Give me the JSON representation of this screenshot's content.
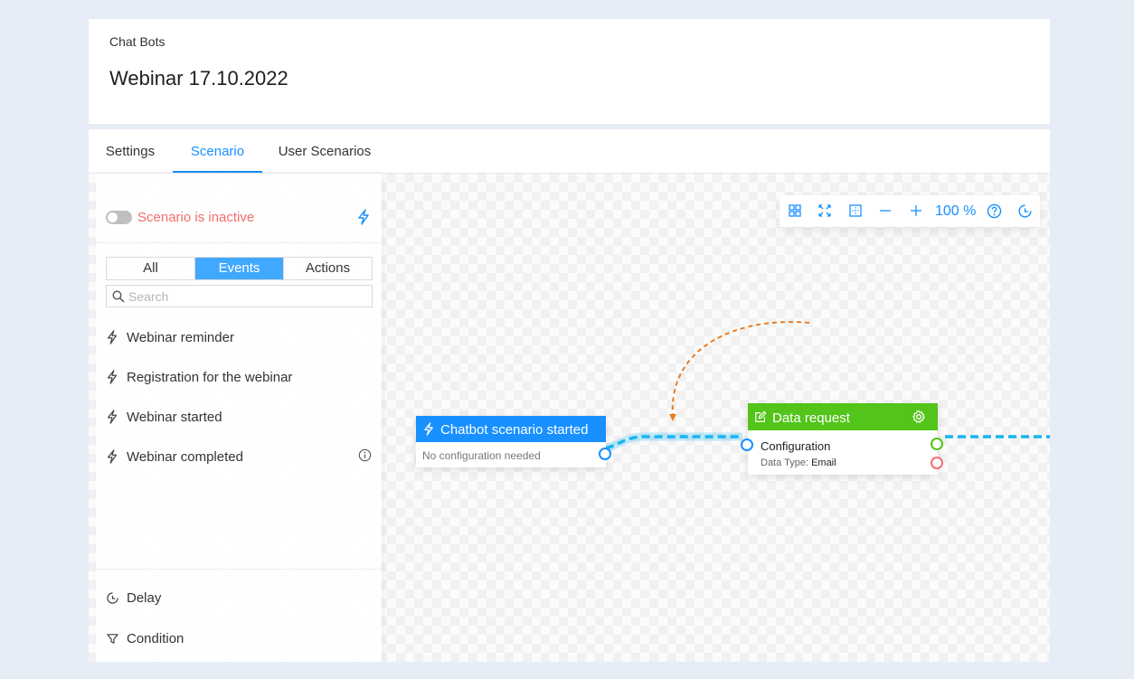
{
  "header": {
    "breadcrumb": "Chat Bots",
    "title": "Webinar 17.10.2022"
  },
  "tabs": [
    {
      "label": "Settings",
      "active": false
    },
    {
      "label": "Scenario",
      "active": true
    },
    {
      "label": "User Scenarios",
      "active": false
    }
  ],
  "panel": {
    "status_text": "Scenario is inactive",
    "filter": [
      "All",
      "Events",
      "Actions"
    ],
    "active_filter": "Events",
    "search_placeholder": "Search",
    "events": [
      {
        "label": "Webinar reminder",
        "icon": "bolt-icon"
      },
      {
        "label": "Registration for the webinar",
        "icon": "bolt-icon"
      },
      {
        "label": "Webinar started",
        "icon": "bolt-icon"
      },
      {
        "label": "Webinar completed",
        "icon": "bolt-icon",
        "info": true
      }
    ],
    "tools": [
      {
        "label": "Delay",
        "icon": "clock-icon"
      },
      {
        "label": "Condition",
        "icon": "filter-icon"
      }
    ]
  },
  "toolbar": {
    "zoom": "100 %",
    "icons": [
      "grid-icon",
      "fullscreen-icon",
      "fit-icon",
      "zoom-out-icon",
      "zoom-in-icon",
      "help-icon",
      "history-icon"
    ]
  },
  "nodes": {
    "start": {
      "title": "Chatbot scenario started",
      "subtitle": "No configuration needed"
    },
    "data_request": {
      "title": "Data request",
      "config_label": "Configuration",
      "data_type_label": "Data Type:",
      "data_type_value": "Email"
    }
  },
  "colors": {
    "accent": "#1890ff",
    "success": "#52c41a",
    "danger": "#f56c6c",
    "link": "#19b5f0",
    "pending_link": "#e67e22"
  }
}
